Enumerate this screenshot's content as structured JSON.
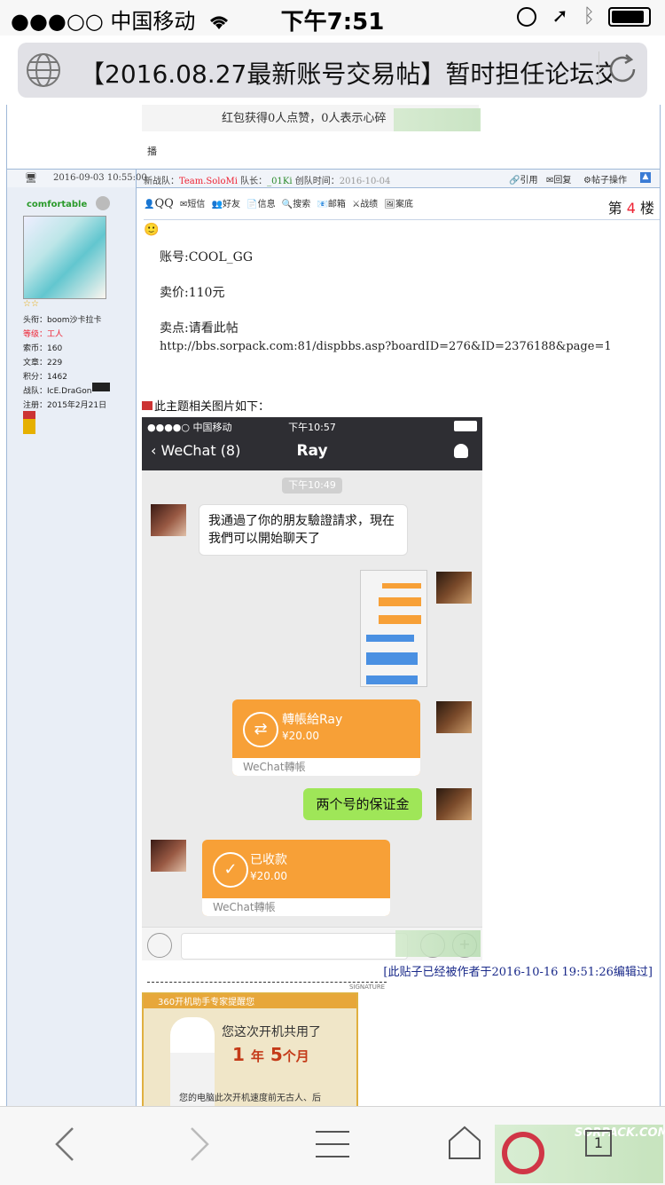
{
  "status_bar": {
    "carrier": "●●●○○ 中国移动",
    "time": "下午7:51"
  },
  "browser": {
    "tab_title": "【2016.08.27最新账号交易帖】暂时担任论坛交"
  },
  "prev_post": {
    "tail_text": "红包获得0人点赞，0人表示心碎",
    "share_label": "播"
  },
  "meta_row": {
    "date": "2016-09-03 10:55:00",
    "team_prefix": "新战队：",
    "team_name": "Team.SoloMi",
    "captain_prefix": " 队长：",
    "captain_name": "_01Ki",
    "created_prefix": " 创队时间：",
    "created_date": "2016-10-04",
    "actions": [
      "引用",
      "回复",
      "帖子操作"
    ]
  },
  "user": {
    "name": "comfortable",
    "stars": "☆☆",
    "stats": [
      {
        "label": "头衔：",
        "value": "boom沙卡拉卡"
      },
      {
        "label": "等级：",
        "value": "工人"
      },
      {
        "label": "索币：",
        "value": "160"
      },
      {
        "label": "文章：",
        "value": "229"
      },
      {
        "label": "积分：",
        "value": "1462"
      },
      {
        "label": "战队：",
        "value": "IcE.DraGon"
      },
      {
        "label": "注册：",
        "value": "2015年2月21日"
      }
    ]
  },
  "post": {
    "toolbar": [
      "QQ",
      "短信",
      "好友",
      "信息",
      "搜索",
      "邮箱",
      "战绩",
      "案底"
    ],
    "floor_prefix": "第",
    "floor_num": "4",
    "floor_suffix": "楼",
    "lines": [
      "账号:COOL_GG",
      "卖价:110元",
      "卖点:请看此帖",
      "http://bbs.sorpack.com:81/dispbbs.asp?boardID=276&ID=2376188&page=1"
    ],
    "images_caption": "此主题相关图片如下：",
    "edit_note": "[此贴子已经被作者于2016-10-16 19:51:26编辑过]",
    "signature_label": "SIGNATURE"
  },
  "wechat": {
    "status_carrier": "●●●●○ 中国移动",
    "status_time": "下午10:57",
    "back_label": "WeChat (8)",
    "contact": "Ray",
    "timestamp": "下午10:49",
    "greeting": "我通過了你的朋友驗證請求，現在我們可以開始聊天了",
    "transfer_title": "轉帳給Ray",
    "transfer_amount": "¥20.00",
    "transfer_foot": "WeChat轉帳",
    "deposit_msg": "两个号的保证金",
    "received_title": "已收款",
    "received_amount": "¥20.00",
    "received_foot": "WeChat轉帳"
  },
  "ad": {
    "header": "360开机助手专家提醒您",
    "line1": "您这次开机共用了",
    "years": "1",
    "years_unit": "年",
    "months": "5",
    "months_unit": "个月",
    "line3": "您的电脑此次开机速度前无古人、后"
  },
  "watermark": "SORPACK.COM",
  "bottom_bar": {
    "tabs_count": "1"
  }
}
